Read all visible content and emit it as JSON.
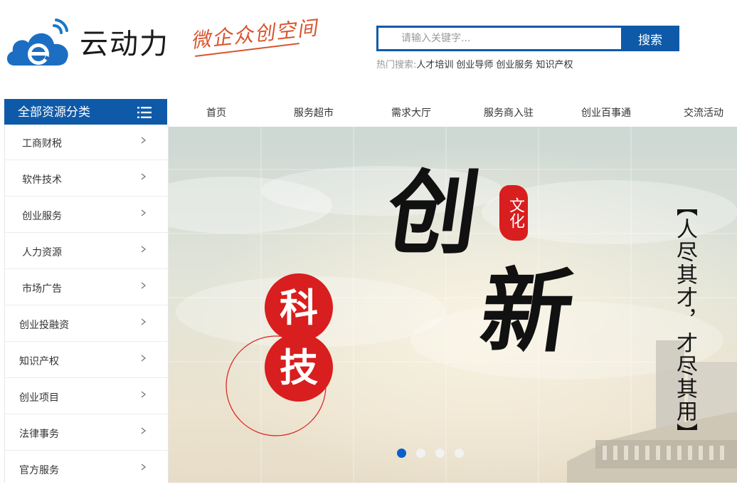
{
  "header": {
    "brand_name": "云动力",
    "slogan": "微企众创空间"
  },
  "search": {
    "placeholder": "请输入关键字...",
    "button_label": "搜索",
    "hot_label": "热门搜索:",
    "hot_terms": [
      "人才培训",
      "创业导师",
      "创业服务",
      "知识产权"
    ]
  },
  "categories": {
    "title": "全部资源分类",
    "items": [
      {
        "label": "工商财税"
      },
      {
        "label": "软件技术"
      },
      {
        "label": "创业服务"
      },
      {
        "label": "人力资源"
      },
      {
        "label": "市场广告"
      },
      {
        "label": "创业投融资"
      },
      {
        "label": "知识产权"
      },
      {
        "label": "创业项目"
      },
      {
        "label": "法律事务"
      },
      {
        "label": "官方服务"
      }
    ]
  },
  "nav": {
    "items": [
      {
        "label": "首页"
      },
      {
        "label": "服务超市"
      },
      {
        "label": "需求大厅"
      },
      {
        "label": "服务商入驻"
      },
      {
        "label": "创业百事通"
      },
      {
        "label": "交流活动"
      }
    ]
  },
  "banner": {
    "main_text": [
      "创",
      "新"
    ],
    "seal_text": "文化",
    "circle_text": [
      "科",
      "技"
    ],
    "vertical_text": "【人尽其才，才尽其用】",
    "slide_count": 4,
    "active_slide": 1
  },
  "colors": {
    "primary": "#0f5aa8",
    "slogan": "#d9542e",
    "accent_red": "#d81e1e",
    "dot_active": "#0a5fc8"
  }
}
